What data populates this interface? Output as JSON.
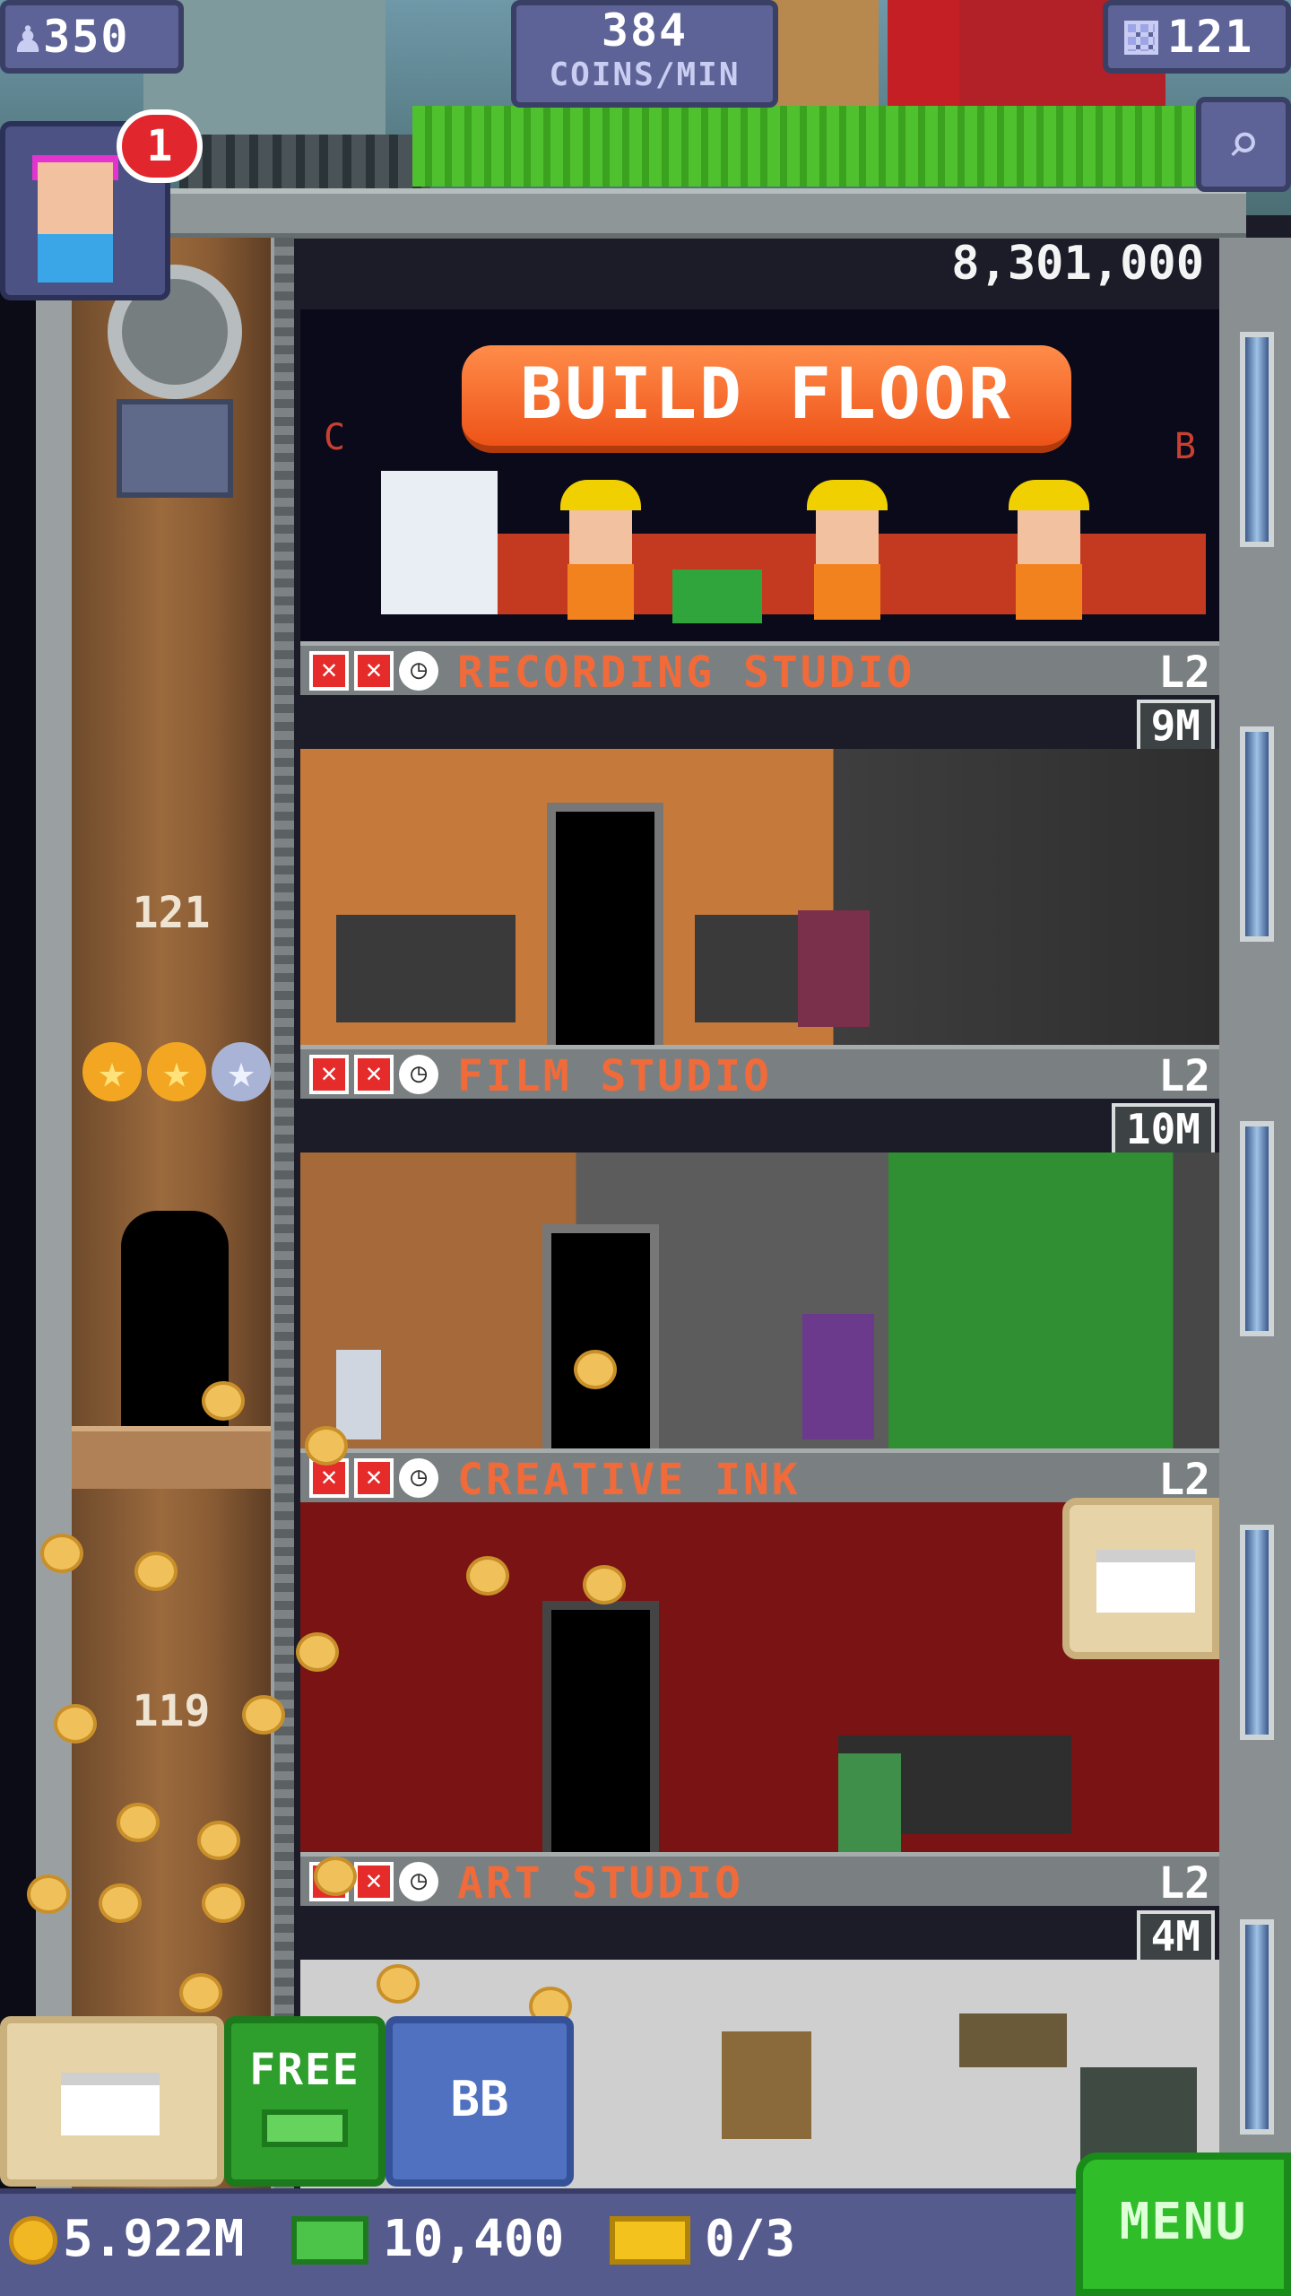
{
  "hud": {
    "population": "350",
    "coins_rate_value": "384",
    "coins_rate_unit": "COINS/MIN",
    "floor_count": "121"
  },
  "notifications": {
    "badge_count": "1"
  },
  "construction": {
    "cost": "8,301,000",
    "button_label": "BUILD FLOOR",
    "left_letter": "C",
    "right_letter": "B"
  },
  "shaft": {
    "upper_floor_number": "121",
    "lower_floor_number": "119",
    "stars_filled": 2,
    "stars_total": 3
  },
  "floors": [
    {
      "name": "RECORDING STUDIO",
      "level": "L2",
      "timer": "9M"
    },
    {
      "name": "FILM STUDIO",
      "level": "L2",
      "timer": "10M"
    },
    {
      "name": "CREATIVE INK",
      "level": "L2",
      "timer": ""
    },
    {
      "name": "ART STUDIO",
      "level": "L2",
      "timer": "4M"
    }
  ],
  "actions": {
    "free_label": "FREE",
    "bb_label": "BB"
  },
  "status": {
    "coins": "5.922M",
    "bux": "10,400",
    "tickets": "0/3",
    "menu_label": "MENU"
  },
  "colors": {
    "hud_bg": "#5d6396",
    "floor_name": "#f06a3a",
    "build_button": "#ee5318",
    "menu_green": "#2fbe2a"
  },
  "icons": {
    "population": "person-icon",
    "floors": "building-grid-icon",
    "search": "magnifier-icon",
    "coin": "coin-icon",
    "bux": "bux-icon",
    "ticket": "golden-ticket-icon"
  }
}
